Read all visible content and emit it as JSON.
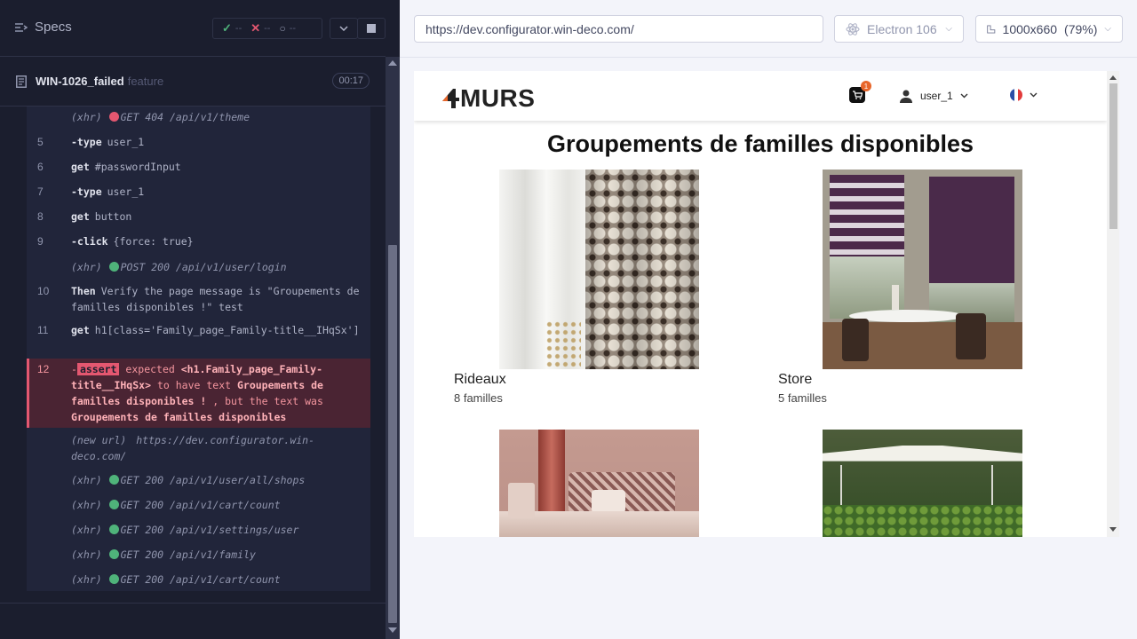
{
  "reporter": {
    "specs_label": "Specs",
    "stats": {
      "passed": "--",
      "failed": "--",
      "pending": "--"
    },
    "spec": {
      "title": "WIN-1026_failed",
      "type": "feature",
      "duration": "00:17"
    },
    "commands": [
      {
        "num": "",
        "kind": "xhr",
        "prefix": "(xhr)",
        "status": "red",
        "text": "GET 404 /api/v1/theme"
      },
      {
        "num": "5",
        "kind": "cmd",
        "name": "-type",
        "msg": "user_1"
      },
      {
        "num": "6",
        "kind": "cmd",
        "name": "get",
        "msg": "#passwordInput"
      },
      {
        "num": "7",
        "kind": "cmd",
        "name": "-type",
        "msg": "user_1"
      },
      {
        "num": "8",
        "kind": "cmd",
        "name": "get",
        "msg": "button"
      },
      {
        "num": "9",
        "kind": "cmd",
        "name": "-click",
        "msg": "{force: true}"
      },
      {
        "num": "",
        "kind": "xhr",
        "prefix": "(xhr)",
        "status": "green",
        "text": "POST 200 /api/v1/user/login"
      },
      {
        "num": "10",
        "kind": "cmd",
        "name": "Then",
        "msg": "Verify the page message is \"Groupements de familles disponibles !\" test"
      },
      {
        "num": "11",
        "kind": "cmd",
        "name": "get",
        "msg": "h1[class='Family_page_Family-title__IHqSx']"
      },
      {
        "num": "",
        "kind": "xhr",
        "prefix": "(new url)",
        "status": "",
        "text": "https://dev.configurator.win-deco.com/"
      },
      {
        "num": "",
        "kind": "xhr",
        "prefix": "(xhr)",
        "status": "green",
        "text": "GET 200 /api/v1/user/all/shops"
      },
      {
        "num": "",
        "kind": "xhr",
        "prefix": "(xhr)",
        "status": "green",
        "text": "GET 200 /api/v1/cart/count"
      },
      {
        "num": "",
        "kind": "xhr",
        "prefix": "(xhr)",
        "status": "green",
        "text": "GET 200 /api/v1/settings/user"
      },
      {
        "num": "",
        "kind": "xhr",
        "prefix": "(xhr)",
        "status": "green",
        "text": "GET 200 /api/v1/family"
      },
      {
        "num": "",
        "kind": "xhr",
        "prefix": "(xhr)",
        "status": "green",
        "text": "GET 200 /api/v1/cart/count"
      }
    ],
    "failed": {
      "num": "12",
      "prefix": "-",
      "tag": "assert",
      "p1": "expected",
      "h1": "<h1.Family_page_Family-title__IHqSx>",
      "p2": "to have text",
      "h2": "Groupements de familles disponibles !",
      "p3": ", but the text was",
      "h3": "Groupements de familles disponibles"
    }
  },
  "preview": {
    "url": "https://dev.configurator.win-deco.com/",
    "browser": "Electron 106",
    "viewport": "1000x660",
    "scale": "(79%)",
    "app": {
      "logo": "MURS",
      "cart_count": "1",
      "user": "user_1",
      "page_title": "Groupements de familles disponibles",
      "families": [
        {
          "name": "Rideaux",
          "count": "8 familles"
        },
        {
          "name": "Store",
          "count": "5 familles"
        },
        {
          "name": "",
          "count": ""
        },
        {
          "name": "",
          "count": ""
        }
      ]
    }
  },
  "colors": {
    "fail": "#e45770",
    "pass": "#4fb37a",
    "accent": "#e8662a"
  }
}
